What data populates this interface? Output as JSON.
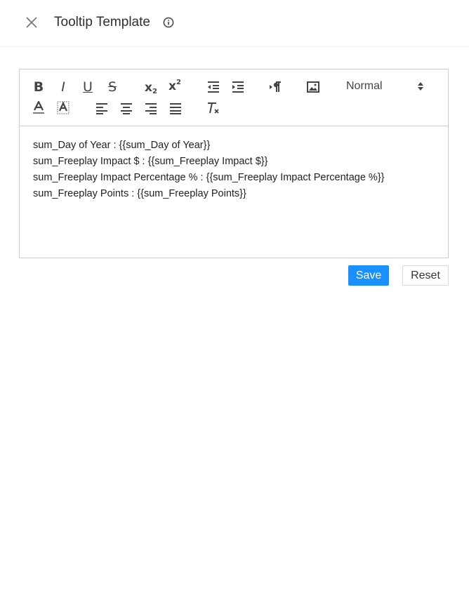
{
  "header": {
    "title": "Tooltip Template"
  },
  "toolbar": {
    "bold": "B",
    "italic": "I",
    "underline": "U",
    "strike": "S",
    "subscript_base": "x",
    "subscript_mark": "2",
    "superscript_base": "x",
    "superscript_mark": "2",
    "header_select": "Normal"
  },
  "editor": {
    "lines": [
      "sum_Day of Year : {{sum_Day of Year}}",
      "sum_Freeplay Impact $ : {{sum_Freeplay Impact $}}",
      "sum_Freeplay Impact Percentage % : {{sum_Freeplay Impact Percentage %}}",
      "sum_Freeplay Points : {{sum_Freeplay Points}}"
    ]
  },
  "actions": {
    "save_label": "Save",
    "reset_label": "Reset"
  },
  "colors": {
    "primary": "#1890ff",
    "border": "#cccccc"
  }
}
